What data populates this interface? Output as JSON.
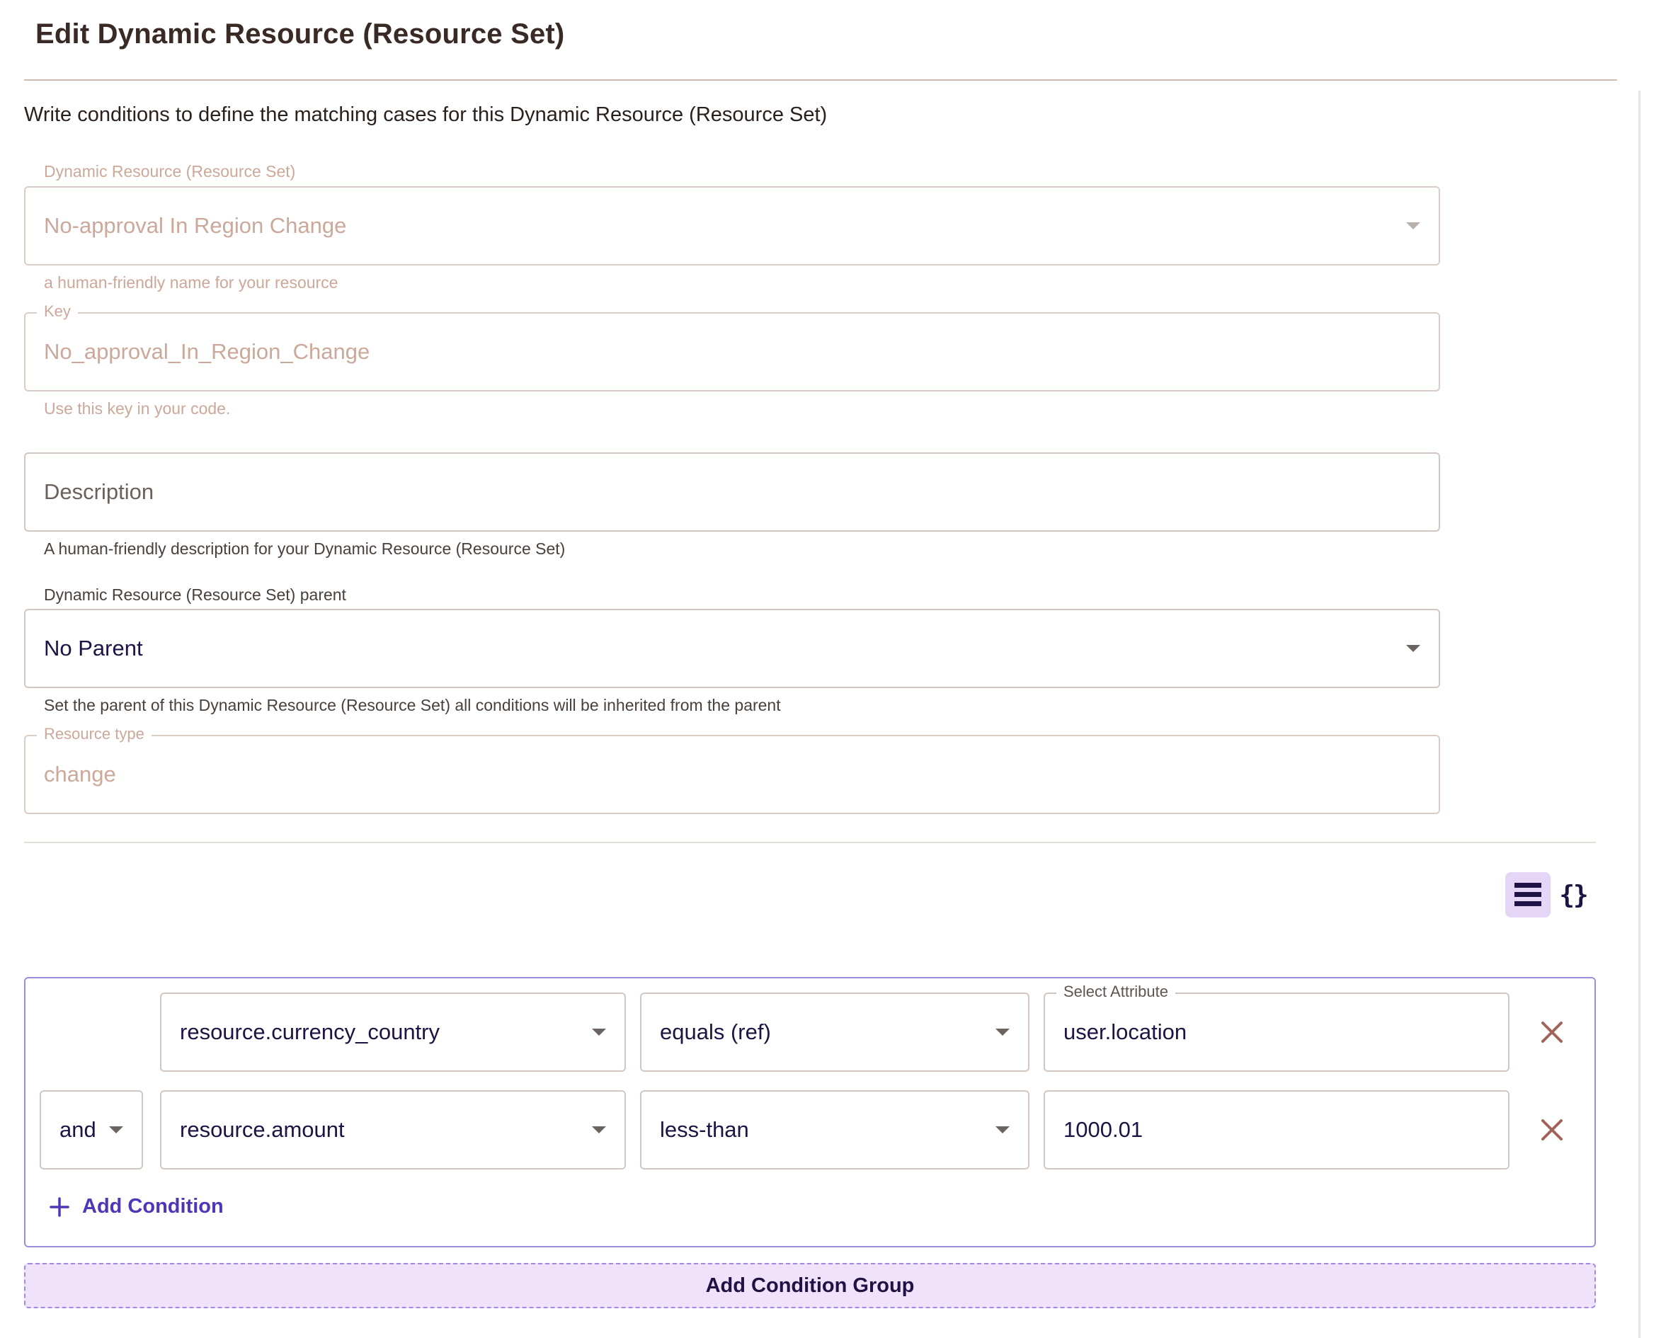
{
  "page": {
    "title": "Edit Dynamic Resource (Resource Set)",
    "intro": "Write conditions to define the matching cases for this Dynamic Resource (Resource Set)"
  },
  "form": {
    "name": {
      "label": "Dynamic Resource (Resource Set)",
      "value": "No-approval In Region Change",
      "helper": "a human-friendly name for your resource"
    },
    "key": {
      "label": "Key",
      "value": "No_approval_In_Region_Change",
      "helper": "Use this key in your code."
    },
    "description": {
      "placeholder": "Description",
      "helper": "A human-friendly description for your Dynamic Resource (Resource Set)"
    },
    "parent": {
      "label": "Dynamic Resource (Resource Set) parent",
      "value": "No Parent",
      "helper": "Set the parent of this Dynamic Resource (Resource Set) all conditions will be inherited from the parent"
    },
    "resource_type": {
      "label": "Resource type",
      "value": "change"
    }
  },
  "view_toggle": {
    "list_icon": "list-icon",
    "json_icon": "braces-icon",
    "braces_glyph": "{}"
  },
  "conditions": {
    "rows": [
      {
        "attribute": "resource.currency_country",
        "operator": "equals (ref)",
        "value_label": "Select Attribute",
        "value": "user.location"
      },
      {
        "conjunction": "and",
        "attribute": "resource.amount",
        "operator": "less-than",
        "value": "1000.01"
      }
    ],
    "add_condition_label": "Add Condition",
    "add_group_label": "Add Condition Group"
  },
  "colors": {
    "accent": "#4f36b8",
    "accent_light": "#efe2fa",
    "group_border": "#9f8ce0",
    "muted_text": "#cba89a",
    "value_text": "#1f1244"
  }
}
